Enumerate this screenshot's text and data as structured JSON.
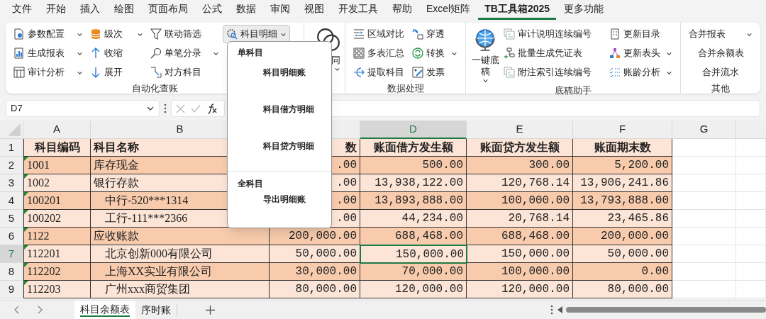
{
  "menu_tabs": [
    {
      "label": "文件",
      "selected": false
    },
    {
      "label": "开始",
      "selected": false
    },
    {
      "label": "插入",
      "selected": false
    },
    {
      "label": "绘图",
      "selected": false
    },
    {
      "label": "页面布局",
      "selected": false
    },
    {
      "label": "公式",
      "selected": false
    },
    {
      "label": "数据",
      "selected": false
    },
    {
      "label": "审阅",
      "selected": false
    },
    {
      "label": "视图",
      "selected": false
    },
    {
      "label": "开发工具",
      "selected": false
    },
    {
      "label": "帮助",
      "selected": false
    },
    {
      "label": "Excel矩阵",
      "selected": false
    },
    {
      "label": "TB工具箱2025",
      "selected": true
    },
    {
      "label": "更多功能",
      "selected": false
    }
  ],
  "ribbon": {
    "groups": [
      {
        "label": "自动化查账",
        "columns": [
          [
            {
              "label": "参数配置",
              "dropdown": true,
              "pressed": false
            },
            {
              "label": "生成报表",
              "dropdown": true,
              "pressed": false
            },
            {
              "label": "审计分析",
              "dropdown": true,
              "pressed": false
            }
          ],
          [
            {
              "label": "级次",
              "dropdown": true,
              "pressed": false
            },
            {
              "label": "收缩",
              "dropdown": false,
              "pressed": false
            },
            {
              "label": "展开",
              "dropdown": false,
              "pressed": false
            }
          ],
          [
            {
              "label": "联动筛选",
              "dropdown": false,
              "pressed": false
            },
            {
              "label": "单笔分录",
              "dropdown": true,
              "pressed": false
            },
            {
              "label": "对方科目",
              "dropdown": false,
              "pressed": false
            }
          ],
          [
            {
              "label": "科目明细",
              "dropdown": true,
              "pressed": true
            }
          ]
        ]
      },
      {
        "large": {
          "label": "同",
          "dropdown": true
        }
      },
      {
        "label": "数据处理",
        "columns": [
          [
            {
              "label": "区域对比",
              "dropdown": false,
              "pressed": false
            },
            {
              "label": "多表汇总",
              "dropdown": false,
              "pressed": false
            },
            {
              "label": "提取科目",
              "dropdown": false,
              "pressed": false
            }
          ],
          [
            {
              "label": "穿透",
              "dropdown": false,
              "pressed": false
            },
            {
              "label": "转换",
              "dropdown": true,
              "pressed": false
            },
            {
              "label": "发票",
              "dropdown": false,
              "pressed": false
            }
          ]
        ]
      },
      {
        "label": "底稿助手",
        "large": {
          "label": "一键底稿",
          "dropdown": true
        },
        "columns": [
          [
            {
              "label": "审计说明连续编号",
              "dropdown": false,
              "pressed": false
            },
            {
              "label": "批量生成凭证表",
              "dropdown": false,
              "pressed": false
            },
            {
              "label": "附注索引连续编号",
              "dropdown": false,
              "pressed": false
            }
          ],
          [
            {
              "label": "更新目录",
              "dropdown": false,
              "pressed": false
            },
            {
              "label": "更新表头",
              "dropdown": true,
              "pressed": false
            },
            {
              "label": "账龄分析",
              "dropdown": true,
              "pressed": false
            }
          ]
        ]
      },
      {
        "label": "其他",
        "columns": [
          [
            {
              "label": "合并报表",
              "dropdown": true,
              "pressed": false
            },
            {
              "label": "合并余额表",
              "dropdown": false,
              "pressed": false
            },
            {
              "label": "合并流水",
              "dropdown": false,
              "pressed": false
            }
          ]
        ]
      }
    ]
  },
  "dropdown_menu": {
    "sections": [
      {
        "heading": "单科目",
        "items": [
          "科目明细账",
          "科目借方明细",
          "科目贷方明细"
        ]
      },
      {
        "heading": "全科目",
        "items": [
          "导出明细账"
        ]
      }
    ]
  },
  "formula_bar": {
    "name_box": "D7"
  },
  "sheet": {
    "columns": [
      {
        "letter": "A",
        "selected": false
      },
      {
        "letter": "B",
        "selected": false
      },
      {
        "selected": false
      },
      {
        "letter": "D",
        "selected": true
      },
      {
        "letter": "E",
        "selected": false
      },
      {
        "letter": "F",
        "selected": false
      },
      {
        "letter": "G",
        "selected": false
      }
    ],
    "header_row": {
      "number": "1",
      "cells": [
        "科目编码",
        "科目名称",
        "数",
        "账面借方发生额",
        "账面贷方发生额",
        "账面期末数"
      ]
    },
    "rows": [
      {
        "number": "2",
        "flag": true,
        "selected": false,
        "cells": [
          "1001",
          "库存现金",
          ".00",
          "500.00",
          "300.00",
          "5,200.00"
        ]
      },
      {
        "number": "3",
        "flag": true,
        "selected": false,
        "cells": [
          "1002",
          "银行存款",
          ".00",
          "13,938,122.00",
          "120,768.14",
          "13,906,241.86"
        ],
        "children": [
          {
            "number": "4",
            "flag": true,
            "selected": false,
            "cells": [
              "100201",
              "中行-520***1314",
              ".00",
              "13,893,888.00",
              "100,000.00",
              "13,793,888.00"
            ]
          },
          {
            "number": "5",
            "flag": true,
            "selected": false,
            "cells": [
              "100202",
              "工行-111***2366",
              ".00",
              "44,234.00",
              "20,768.14",
              "23,465.86"
            ]
          }
        ]
      },
      {
        "number": "6",
        "flag": true,
        "selected": false,
        "cells": [
          "1122",
          "应收账款",
          "200,000.00",
          "688,468.00",
          "688,468.00",
          "200,000.00"
        ],
        "children": [
          {
            "number": "7",
            "flag": true,
            "selected": true,
            "cells": [
              "112201",
              "北京创新000有限公司",
              "50,000.00",
              "150,000.00",
              "150,000.00",
              "50,000.00"
            ]
          },
          {
            "number": "8",
            "flag": true,
            "selected": false,
            "cells": [
              "112202",
              "上海XX实业有限公司",
              "30,000.00",
              "70,000.00",
              "100,000.00",
              "0.00"
            ]
          },
          {
            "number": "9",
            "flag": true,
            "selected": false,
            "cells": [
              "112203",
              "广州xxx商贸集团",
              "80,000.00",
              "120,000.00",
              "120,000.00",
              "80,000.00"
            ]
          }
        ]
      }
    ]
  },
  "sheet_tabs": [
    {
      "label": "科目余额表",
      "selected": true
    },
    {
      "label": "序时账",
      "selected": false
    }
  ]
}
